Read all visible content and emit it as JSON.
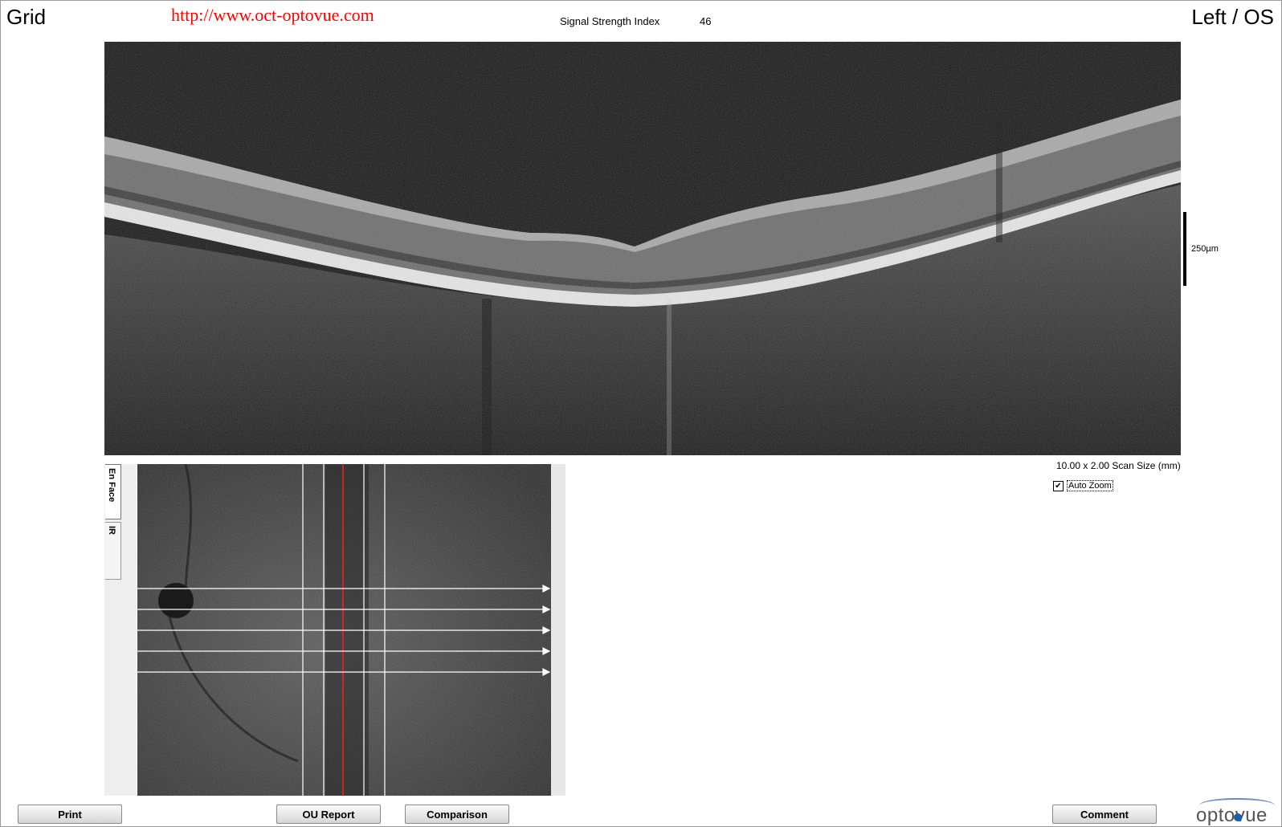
{
  "header": {
    "mode": "Grid",
    "eye": "Left / OS",
    "url_watermark": "http://www.oct-optovue.com",
    "signal_strength_label": "Signal Strength Index",
    "signal_strength_value": "46"
  },
  "bscan": {
    "scale_bar_label": "250µm",
    "scan_size": "10.00 x 2.00 Scan Size (mm)",
    "auto_zoom_label": "Auto Zoom",
    "auto_zoom_checked": true
  },
  "enface": {
    "tabs": [
      {
        "label": "En Face",
        "active": true
      },
      {
        "label": "IR",
        "active": false
      }
    ],
    "horizontal_scan_lines": 5,
    "vertical_guide_lines": 4
  },
  "buttons": {
    "print": "Print",
    "ou_report": "OU Report",
    "comparison": "Comparison",
    "comment": "Comment"
  },
  "logo": {
    "text": "optovue",
    "accent_color": "#1a5fa8"
  },
  "colors": {
    "url_color": "#ff0000",
    "marker_color": "#ff2020"
  }
}
